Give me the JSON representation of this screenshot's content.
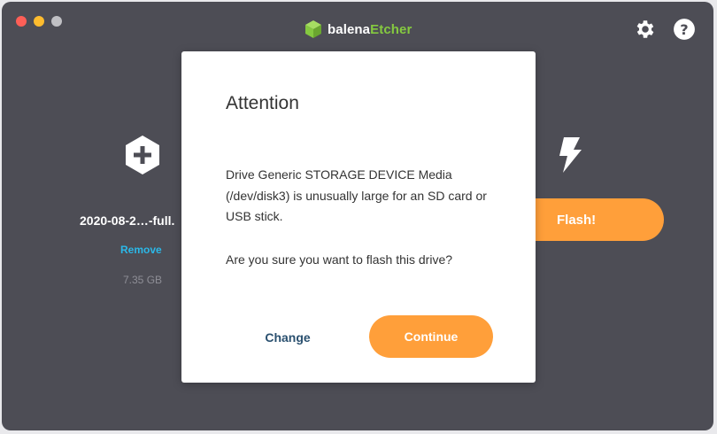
{
  "window": {
    "brand_prefix": "balena",
    "brand_suffix": "Etcher",
    "brand_color": "#85c940"
  },
  "header_icons": [
    "settings-icon",
    "help-icon"
  ],
  "image": {
    "name": "2020-08-2…-full.",
    "remove_label": "Remove",
    "size": "7.35 GB"
  },
  "flash": {
    "label": "Flash!",
    "color": "#ff9f3a"
  },
  "dialog": {
    "title": "Attention",
    "message": "Drive Generic STORAGE DEVICE Media (/dev/disk3) is unusually large for an SD card or USB stick.",
    "question": "Are you sure you want to flash this drive?",
    "change_label": "Change",
    "continue_label": "Continue"
  },
  "colors": {
    "window_bg": "#4d4d55",
    "link": "#2bb8e8",
    "change_text": "#2a506f"
  }
}
